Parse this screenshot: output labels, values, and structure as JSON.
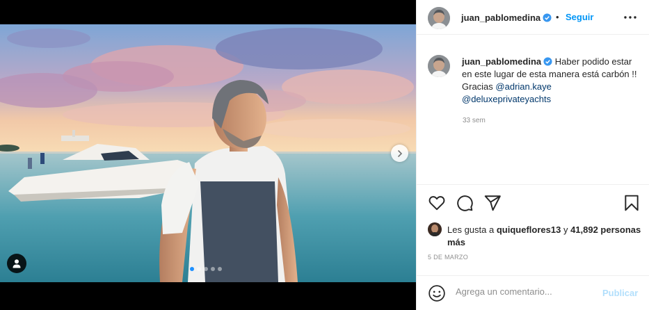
{
  "post": {
    "author": {
      "username": "juan_pablomedina",
      "verified": true,
      "follow_label": "Seguir",
      "separator": "•"
    },
    "caption": {
      "text_before": "Haber podido estar en este lugar de esta manera está carbón !! Gracias",
      "mentions": [
        "@adrian.kaye",
        "@deluxeprivateyachts"
      ],
      "time": "33 sem"
    },
    "likes": {
      "prefix": "Les gusta a",
      "user": "quiqueflores13",
      "joiner": "y",
      "others": "41,892 personas más"
    },
    "date": "5 DE MARZO",
    "comment": {
      "placeholder": "Agrega un comentario...",
      "publish_label": "Publicar"
    },
    "carousel": {
      "total": 5,
      "active": 1
    }
  },
  "icons": {
    "header_more": "more-options-icon",
    "like": "heart-icon",
    "comment": "comment-icon",
    "share": "paper-plane-icon",
    "save": "bookmark-icon",
    "emoji": "emoji-icon",
    "next": "chevron-right-icon",
    "tag": "user-tag-icon"
  },
  "colors": {
    "link_blue": "#0095f6",
    "mention": "#00376b",
    "publish_disabled": "#b2dffc",
    "verified": "#3897f0",
    "active_dot": "#1e90ff"
  }
}
